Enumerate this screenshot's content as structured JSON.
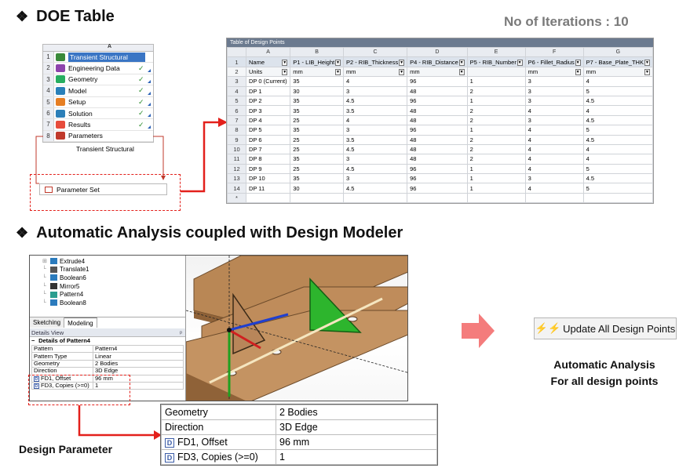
{
  "doe": {
    "heading": "DOE Table",
    "bullet": "❖",
    "iterations": "No of Iterations : 10"
  },
  "schematic": {
    "column": "A",
    "rows": [
      {
        "n": "1",
        "label": "Transient Structural",
        "check": "",
        "icon": "transient-icon"
      },
      {
        "n": "2",
        "label": "Engineering Data",
        "check": "✓",
        "icon": "engineering-data-icon"
      },
      {
        "n": "3",
        "label": "Geometry",
        "check": "✓",
        "icon": "geometry-icon"
      },
      {
        "n": "4",
        "label": "Model",
        "check": "✓",
        "icon": "model-icon"
      },
      {
        "n": "5",
        "label": "Setup",
        "check": "✓",
        "icon": "setup-icon"
      },
      {
        "n": "6",
        "label": "Solution",
        "check": "✓",
        "icon": "solution-icon"
      },
      {
        "n": "7",
        "label": "Results",
        "check": "✓",
        "icon": "results-icon"
      },
      {
        "n": "8",
        "label": "Parameters",
        "check": "",
        "icon": "parameters-icon"
      }
    ],
    "caption": "Transient Structural",
    "parameter_set": "Parameter Set"
  },
  "dp_table": {
    "title": "Table of Design Points",
    "columns": [
      "A",
      "B",
      "C",
      "D",
      "E",
      "F",
      "G"
    ],
    "names": [
      "Name",
      "P1 - LIB_Height",
      "P2 - RIB_Thickness",
      "P4 - RIB_Distance",
      "P5 - RIB_Number",
      "P6 - Fillet_Radius",
      "P7 - Base_Plate_THK"
    ],
    "units": [
      "Units",
      "mm",
      "mm",
      "mm",
      "",
      "mm",
      "mm"
    ],
    "rows": [
      [
        "DP 0 (Current)",
        "35",
        "4",
        "96",
        "1",
        "3",
        "4"
      ],
      [
        "DP 1",
        "30",
        "3",
        "48",
        "2",
        "3",
        "5"
      ],
      [
        "DP 2",
        "35",
        "4.5",
        "96",
        "1",
        "3",
        "4.5"
      ],
      [
        "DP 3",
        "35",
        "3.5",
        "48",
        "2",
        "4",
        "4"
      ],
      [
        "DP 4",
        "25",
        "4",
        "48",
        "2",
        "3",
        "4.5"
      ],
      [
        "DP 5",
        "35",
        "3",
        "96",
        "1",
        "4",
        "5"
      ],
      [
        "DP 6",
        "25",
        "3.5",
        "48",
        "2",
        "4",
        "4.5"
      ],
      [
        "DP 7",
        "25",
        "4.5",
        "48",
        "2",
        "4",
        "4"
      ],
      [
        "DP 8",
        "35",
        "3",
        "48",
        "2",
        "4",
        "4"
      ],
      [
        "DP 9",
        "25",
        "4.5",
        "96",
        "1",
        "4",
        "5"
      ],
      [
        "DP 10",
        "35",
        "3",
        "96",
        "1",
        "3",
        "4.5"
      ],
      [
        "DP 11",
        "30",
        "4.5",
        "96",
        "1",
        "4",
        "5"
      ]
    ],
    "row_numbers": [
      "1",
      "2",
      "3",
      "4",
      "5",
      "6",
      "7",
      "8",
      "9",
      "10",
      "11",
      "12",
      "13",
      "14",
      "*"
    ]
  },
  "dm": {
    "heading": "Automatic Analysis coupled with Design Modeler",
    "tree": [
      "Extrude4",
      "Translate1",
      "Boolean6",
      "Mirror5",
      "Pattern4",
      "Boolean8"
    ],
    "tabs": [
      "Sketching",
      "Modeling"
    ],
    "details_title": "Details View",
    "details_sub": "Details of Pattern4",
    "details": [
      [
        "Pattern",
        "Pattern4"
      ],
      [
        "Pattern Type",
        "Linear"
      ],
      [
        "Geometry",
        "2 Bodies"
      ],
      [
        "Direction",
        "3D Edge"
      ],
      [
        "FD1, Offset",
        "96 mm"
      ],
      [
        "FD3, Copies (>=0)",
        "1"
      ]
    ],
    "pin": "ᵖ"
  },
  "zoom": {
    "rows": [
      [
        "Geometry",
        "2 Bodies"
      ],
      [
        "Direction",
        "3D Edge"
      ],
      [
        "FD1, Offset",
        "96 mm"
      ],
      [
        "FD3, Copies (>=0)",
        "1"
      ]
    ],
    "badge": "D"
  },
  "labels": {
    "design_parameter": "Design Parameter",
    "update_button": "Update All Design Points",
    "auto_line1": "Automatic Analysis",
    "auto_line2": "For all design points"
  },
  "colors": {
    "accent_red": "#e3201b",
    "arrow_pink": "#f47c7c",
    "selected_blue": "#3a75c4",
    "plate_brown": "#b8865a"
  }
}
